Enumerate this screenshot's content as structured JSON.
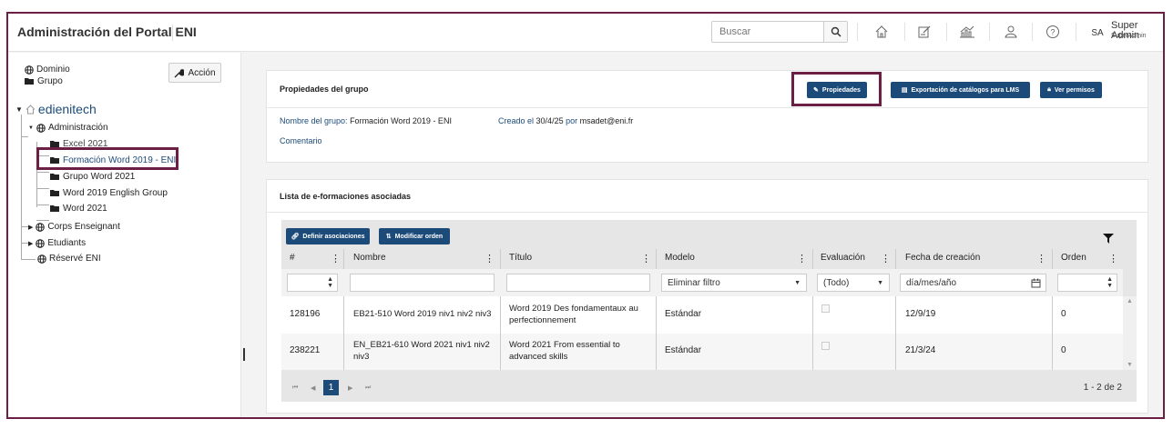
{
  "app": {
    "title": "Administración del Portal ENI"
  },
  "search": {
    "placeholder": "Buscar"
  },
  "user": {
    "initials": "SA",
    "name": "Super Admin",
    "role": "SuperAdmin"
  },
  "topbar_icons": [
    "home-icon",
    "edit-note-icon",
    "chart-icon",
    "user-icon",
    "help-icon"
  ],
  "sidebar": {
    "dominio": "Dominio",
    "grupo": "Grupo",
    "accion": "Acción",
    "root": "edienitech",
    "admin": "Administración",
    "groups": [
      "Excel 2021",
      "Formación Word 2019 - ENI",
      "Grupo Word 2021",
      "Word 2019 English Group",
      "Word 2021"
    ],
    "others": [
      "Corps Enseignant",
      "Etudiants",
      "Réservé ENI"
    ]
  },
  "group_props": {
    "title": "Propiedades del grupo",
    "btn_propiedades": "Propiedades",
    "btn_export": "Exportación de catálogos para LMS",
    "btn_permisos": "Ver permisos",
    "name_label": "Nombre del grupo:",
    "name_value": "Formación Word 2019 - ENI",
    "created_label": "Creado el",
    "created_date": "30/4/25",
    "created_by_label": "por",
    "created_by": "msadet@eni.fr",
    "comment_label": "Comentario"
  },
  "list": {
    "title": "Lista de e-formaciones asociadas",
    "btn_definir": "Definir asociaciones",
    "btn_modificar": "Modificar orden",
    "columns": [
      "#",
      "Nombre",
      "Título",
      "Modelo",
      "Evaluación",
      "Fecha de creación",
      "Orden"
    ],
    "filters": {
      "modelo": "Eliminar filtro",
      "evaluacion": "(Todo)",
      "fecha_placeholder": "día/mes/año"
    },
    "rows": [
      {
        "id": "128196",
        "nombre": "EB21-510 Word 2019 niv1 niv2 niv3",
        "titulo": "Word 2019 Des fondamentaux au perfectionnement",
        "modelo": "Estándar",
        "fecha": "12/9/19",
        "orden": "0"
      },
      {
        "id": "238221",
        "nombre": "EN_EB21-610 Word 2021 niv1 niv2 niv3",
        "titulo": "Word 2021 From essential to advanced skills",
        "modelo": "Estándar",
        "fecha": "21/3/24",
        "orden": "0"
      }
    ],
    "pager": {
      "page": "1",
      "summary": "1 - 2 de 2"
    }
  },
  "colors": {
    "accent": "#1c4b7a",
    "highlight": "#6b1f45"
  }
}
